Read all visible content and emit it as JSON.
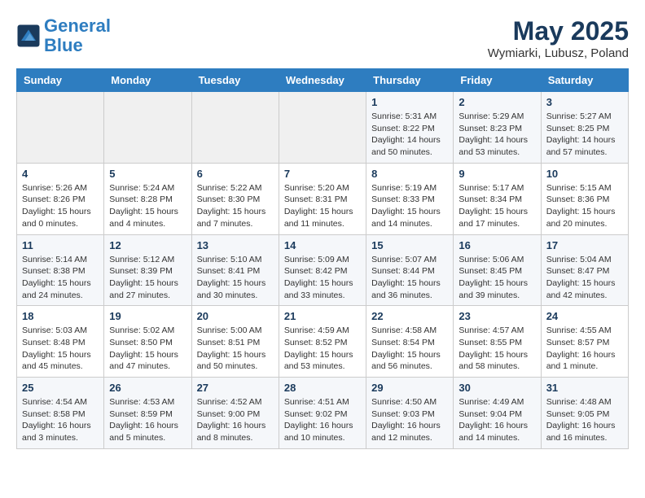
{
  "header": {
    "logo_line1": "General",
    "logo_line2": "Blue",
    "month": "May 2025",
    "location": "Wymiarki, Lubusz, Poland"
  },
  "weekdays": [
    "Sunday",
    "Monday",
    "Tuesday",
    "Wednesday",
    "Thursday",
    "Friday",
    "Saturday"
  ],
  "weeks": [
    [
      {
        "day": "",
        "detail": ""
      },
      {
        "day": "",
        "detail": ""
      },
      {
        "day": "",
        "detail": ""
      },
      {
        "day": "",
        "detail": ""
      },
      {
        "day": "1",
        "detail": "Sunrise: 5:31 AM\nSunset: 8:22 PM\nDaylight: 14 hours\nand 50 minutes."
      },
      {
        "day": "2",
        "detail": "Sunrise: 5:29 AM\nSunset: 8:23 PM\nDaylight: 14 hours\nand 53 minutes."
      },
      {
        "day": "3",
        "detail": "Sunrise: 5:27 AM\nSunset: 8:25 PM\nDaylight: 14 hours\nand 57 minutes."
      }
    ],
    [
      {
        "day": "4",
        "detail": "Sunrise: 5:26 AM\nSunset: 8:26 PM\nDaylight: 15 hours\nand 0 minutes."
      },
      {
        "day": "5",
        "detail": "Sunrise: 5:24 AM\nSunset: 8:28 PM\nDaylight: 15 hours\nand 4 minutes."
      },
      {
        "day": "6",
        "detail": "Sunrise: 5:22 AM\nSunset: 8:30 PM\nDaylight: 15 hours\nand 7 minutes."
      },
      {
        "day": "7",
        "detail": "Sunrise: 5:20 AM\nSunset: 8:31 PM\nDaylight: 15 hours\nand 11 minutes."
      },
      {
        "day": "8",
        "detail": "Sunrise: 5:19 AM\nSunset: 8:33 PM\nDaylight: 15 hours\nand 14 minutes."
      },
      {
        "day": "9",
        "detail": "Sunrise: 5:17 AM\nSunset: 8:34 PM\nDaylight: 15 hours\nand 17 minutes."
      },
      {
        "day": "10",
        "detail": "Sunrise: 5:15 AM\nSunset: 8:36 PM\nDaylight: 15 hours\nand 20 minutes."
      }
    ],
    [
      {
        "day": "11",
        "detail": "Sunrise: 5:14 AM\nSunset: 8:38 PM\nDaylight: 15 hours\nand 24 minutes."
      },
      {
        "day": "12",
        "detail": "Sunrise: 5:12 AM\nSunset: 8:39 PM\nDaylight: 15 hours\nand 27 minutes."
      },
      {
        "day": "13",
        "detail": "Sunrise: 5:10 AM\nSunset: 8:41 PM\nDaylight: 15 hours\nand 30 minutes."
      },
      {
        "day": "14",
        "detail": "Sunrise: 5:09 AM\nSunset: 8:42 PM\nDaylight: 15 hours\nand 33 minutes."
      },
      {
        "day": "15",
        "detail": "Sunrise: 5:07 AM\nSunset: 8:44 PM\nDaylight: 15 hours\nand 36 minutes."
      },
      {
        "day": "16",
        "detail": "Sunrise: 5:06 AM\nSunset: 8:45 PM\nDaylight: 15 hours\nand 39 minutes."
      },
      {
        "day": "17",
        "detail": "Sunrise: 5:04 AM\nSunset: 8:47 PM\nDaylight: 15 hours\nand 42 minutes."
      }
    ],
    [
      {
        "day": "18",
        "detail": "Sunrise: 5:03 AM\nSunset: 8:48 PM\nDaylight: 15 hours\nand 45 minutes."
      },
      {
        "day": "19",
        "detail": "Sunrise: 5:02 AM\nSunset: 8:50 PM\nDaylight: 15 hours\nand 47 minutes."
      },
      {
        "day": "20",
        "detail": "Sunrise: 5:00 AM\nSunset: 8:51 PM\nDaylight: 15 hours\nand 50 minutes."
      },
      {
        "day": "21",
        "detail": "Sunrise: 4:59 AM\nSunset: 8:52 PM\nDaylight: 15 hours\nand 53 minutes."
      },
      {
        "day": "22",
        "detail": "Sunrise: 4:58 AM\nSunset: 8:54 PM\nDaylight: 15 hours\nand 56 minutes."
      },
      {
        "day": "23",
        "detail": "Sunrise: 4:57 AM\nSunset: 8:55 PM\nDaylight: 15 hours\nand 58 minutes."
      },
      {
        "day": "24",
        "detail": "Sunrise: 4:55 AM\nSunset: 8:57 PM\nDaylight: 16 hours\nand 1 minute."
      }
    ],
    [
      {
        "day": "25",
        "detail": "Sunrise: 4:54 AM\nSunset: 8:58 PM\nDaylight: 16 hours\nand 3 minutes."
      },
      {
        "day": "26",
        "detail": "Sunrise: 4:53 AM\nSunset: 8:59 PM\nDaylight: 16 hours\nand 5 minutes."
      },
      {
        "day": "27",
        "detail": "Sunrise: 4:52 AM\nSunset: 9:00 PM\nDaylight: 16 hours\nand 8 minutes."
      },
      {
        "day": "28",
        "detail": "Sunrise: 4:51 AM\nSunset: 9:02 PM\nDaylight: 16 hours\nand 10 minutes."
      },
      {
        "day": "29",
        "detail": "Sunrise: 4:50 AM\nSunset: 9:03 PM\nDaylight: 16 hours\nand 12 minutes."
      },
      {
        "day": "30",
        "detail": "Sunrise: 4:49 AM\nSunset: 9:04 PM\nDaylight: 16 hours\nand 14 minutes."
      },
      {
        "day": "31",
        "detail": "Sunrise: 4:48 AM\nSunset: 9:05 PM\nDaylight: 16 hours\nand 16 minutes."
      }
    ]
  ]
}
